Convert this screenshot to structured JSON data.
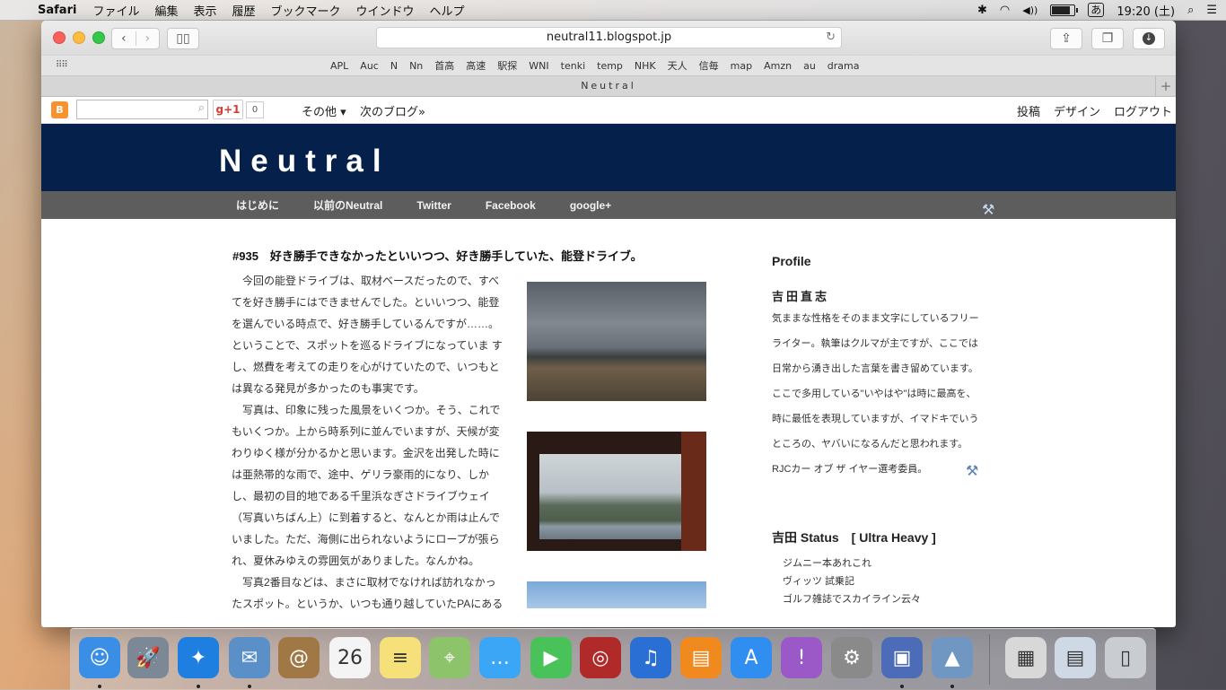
{
  "menubar": {
    "apple": "",
    "app_name": "Safari",
    "items": [
      "ファイル",
      "編集",
      "表示",
      "履歴",
      "ブックマーク",
      "ウインドウ",
      "ヘルプ"
    ],
    "status": {
      "bluetooth": "✱",
      "wifi": "◠",
      "volume": "◀))",
      "battery_level": 0.9,
      "input_method": "あ",
      "clock": "19:20 (土)",
      "spotlight": "⌕",
      "notifications": "☰"
    }
  },
  "browser": {
    "url": "neutral11.blogspot.jp",
    "reload_icon": "↻",
    "favorites": [
      "APL",
      "Auc",
      "N",
      "Nn",
      "首高",
      "高速",
      "駅探",
      "WNI",
      "tenki",
      "temp",
      "NHK",
      "天人",
      "信毎",
      "map",
      "Amzn",
      "au",
      "drama"
    ],
    "tab_title": "Neutral",
    "new_tab": "+"
  },
  "blogger_bar": {
    "gplus_label": "g+1",
    "gplus_count": "0",
    "more": "その他 ▾",
    "next_blog": "次のブログ»",
    "right_links": [
      "投稿",
      "デザイン",
      "ログアウト"
    ]
  },
  "blog": {
    "title": "Neutral",
    "menu": [
      "はじめに",
      "以前のNeutral",
      "Twitter",
      "Facebook",
      "google+"
    ]
  },
  "post": {
    "title": "#935　好き勝手できなかったといいつつ、好き勝手していた、能登ドライブ。",
    "lines": [
      "今回の能登ドライブは、取材ベースだったので、すべ",
      "てを好き勝手にはできませんでした。といいつつ、能登",
      "を選んでいる時点で、好き勝手しているんですが……。",
      "ということで、スポットを巡るドライブになっていま す",
      "し、燃費を考えての走りを心がけていたので、いつもと",
      "は異なる発見が多かったのも事実です。",
      "写真は、印象に残った風景をいくつか。そう、これで",
      "もいくつか。上から時系列に並んでいますが、天候が変",
      "わりゆく様が分かるかと思います。金沢を出発した時に",
      "は亜熱帯的な雨で、途中、ゲリラ豪雨的になり、しか",
      "し、最初の目的地である千里浜なぎさドライブウェイ",
      "（写真いちばん上）に到着すると、なんとか雨は止んで",
      "いました。ただ、海側に出られないようにロープが張ら",
      "れ、夏休みゆえの雰囲気がありました。なんかね。",
      "写真2番目などは、まさに取材でなければ訪れなかっ",
      "たスポット。というか、いつも通り越していたPAにある"
    ]
  },
  "sidebar": {
    "profile_heading": "Profile",
    "name": "吉田直志",
    "bio": [
      "気ままな性格をそのまま文字にしているフリー",
      "ライター。執筆はクルマが主ですが、ここでは",
      "日常から湧き出した言葉を書き留めています。",
      "ここで多用している\"いやはや\"は時に最高を、",
      "時に最低を表現していますが、イマドキでいう",
      "ところの、ヤバいになるんだと思われます。",
      "RJCカー オブ ザ イヤー選考委員。"
    ],
    "status_heading": "吉田 Status　[ Ultra Heavy ]",
    "status_links": [
      "ジムニー本あれこれ",
      "ヴィッツ 試乗記",
      "ゴルフ雑誌でスカイライン云々"
    ]
  },
  "dock": {
    "apps": [
      {
        "name": "finder",
        "glyph": "☺",
        "color": "#3a8ee6"
      },
      {
        "name": "launchpad",
        "glyph": "🚀",
        "color": "#7d8896"
      },
      {
        "name": "safari",
        "glyph": "✦",
        "color": "#1f7fe0"
      },
      {
        "name": "mail",
        "glyph": "✉",
        "color": "#5a8fc8"
      },
      {
        "name": "contacts",
        "glyph": "@",
        "color": "#a07845"
      },
      {
        "name": "calendar",
        "glyph": "26",
        "color": "#f4f4f4"
      },
      {
        "name": "notes",
        "glyph": "≡",
        "color": "#f6e07a"
      },
      {
        "name": "maps",
        "glyph": "⌖",
        "color": "#8cc36b"
      },
      {
        "name": "messages",
        "glyph": "…",
        "color": "#3aa6f5"
      },
      {
        "name": "facetime",
        "glyph": "▶",
        "color": "#49c25a"
      },
      {
        "name": "photo-booth",
        "glyph": "◎",
        "color": "#b02a2a"
      },
      {
        "name": "itunes",
        "glyph": "♫",
        "color": "#2a6fd4"
      },
      {
        "name": "ibooks",
        "glyph": "▤",
        "color": "#f08a1e"
      },
      {
        "name": "app-store",
        "glyph": "A",
        "color": "#2f8ef0"
      },
      {
        "name": "feedback",
        "glyph": "!",
        "color": "#9b59c7"
      },
      {
        "name": "system-preferences",
        "glyph": "⚙",
        "color": "#8a8a8a"
      },
      {
        "name": "preview",
        "glyph": "▣",
        "color": "#4c6cb8"
      },
      {
        "name": "image-viewer",
        "glyph": "▲",
        "color": "#7097c2"
      },
      {
        "name": "documents",
        "glyph": "▦",
        "color": "#d8d8d8"
      },
      {
        "name": "screenshots",
        "glyph": "▤",
        "color": "#cfd9e6"
      },
      {
        "name": "trash",
        "glyph": "▯",
        "color": "#c9ccd0"
      }
    ],
    "running": [
      true,
      false,
      true,
      true,
      false,
      false,
      false,
      false,
      false,
      false,
      false,
      false,
      false,
      false,
      false,
      false,
      true,
      true,
      false,
      false,
      false
    ]
  }
}
